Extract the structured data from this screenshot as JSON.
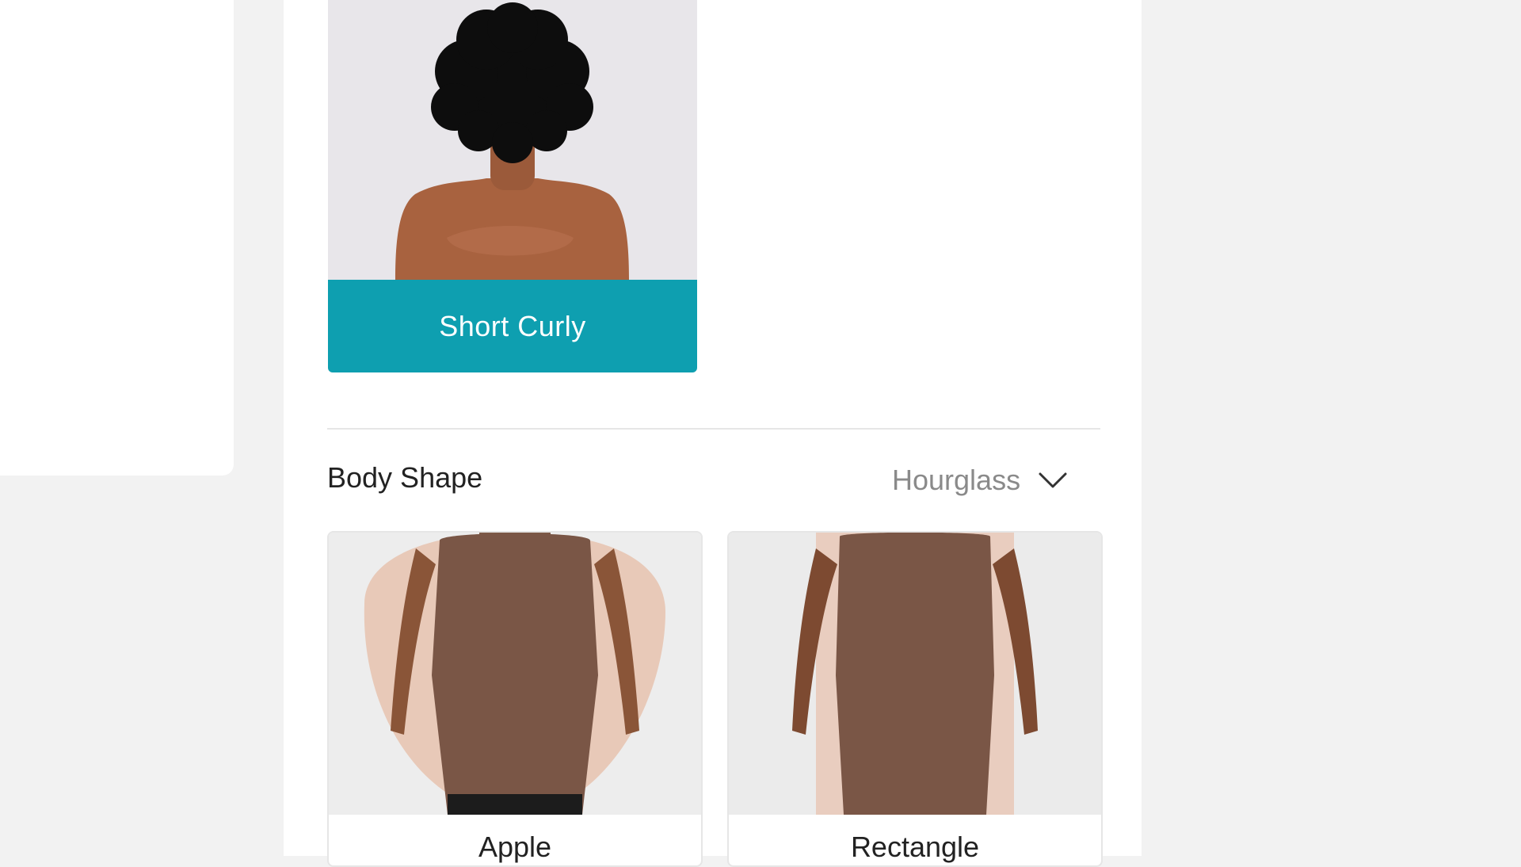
{
  "hair": {
    "selected_label": "Short Curly",
    "accent_color": "#0e9fb0"
  },
  "body_shape": {
    "title": "Body Shape",
    "selected_value": "Hourglass",
    "cards": [
      {
        "label": "Apple"
      },
      {
        "label": "Rectangle"
      }
    ]
  },
  "icons": {
    "dropdown": "chevron-down-icon"
  }
}
